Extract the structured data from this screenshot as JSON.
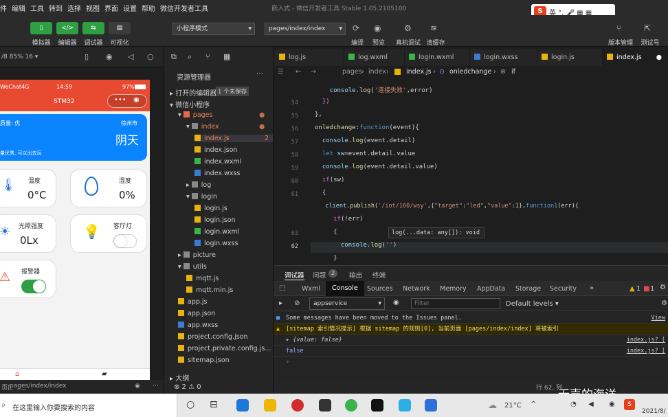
{
  "menu": [
    "件",
    "编辑",
    "工具",
    "转到",
    "选择",
    "视图",
    "界面",
    "设置",
    "帮助",
    "微信开发者工具"
  ],
  "window_title": "嵌入式 - 微信开发者工具 Stable 1.05.2105100",
  "ime": {
    "logo": "S",
    "text": "英 °, 🎤 ▦ ▦"
  },
  "toolbar": {
    "buttons": [
      {
        "label": "模拟器",
        "color": "#2ea043"
      },
      {
        "label": "编辑器",
        "color": "#2ea043"
      },
      {
        "label": "调试器",
        "color": "#2ea043"
      },
      {
        "label": "可视化",
        "color": "#3c3c3c"
      }
    ],
    "mode_select": "小程序模式",
    "page_select": "pages/index/index",
    "actions": [
      "编译",
      "预览",
      "真机调试",
      "清缓存"
    ],
    "right_actions": [
      "版本管理",
      "测试号"
    ]
  },
  "sim_header": {
    "zoom": "/8 85% 16 ▾"
  },
  "phone": {
    "status_carrier": "WeChat4G",
    "status_time": "14:59",
    "status_battery": "97%",
    "nav_title": "STM32",
    "weather": {
      "quality": "质量: 优",
      "city": "徐州市",
      "condition": "阴天",
      "tip": "量优秀, 可以出去玩"
    },
    "cards": [
      {
        "title": "温度",
        "value": "0°C",
        "icon": "thermometer-icon"
      },
      {
        "title": "湿度",
        "value": "0%",
        "icon": "water-drop-icon"
      },
      {
        "title": "光照强度",
        "value": "0Lx",
        "icon": "sun-icon"
      },
      {
        "title": "客厅灯",
        "value": "",
        "icon": "bulb-icon",
        "switch": false
      },
      {
        "title": "报警器",
        "value": "",
        "icon": "alarm-icon",
        "switch": true
      }
    ]
  },
  "sim_footer": {
    "path": "pages/index/index"
  },
  "explorer": {
    "title": "资源管理器",
    "open_editors": "打开的编辑器",
    "unsaved": "1 个未保存",
    "project": "微信小程序",
    "items": [
      {
        "name": "pages",
        "depth": 1,
        "kind": "folder",
        "dot": true
      },
      {
        "name": "index",
        "depth": 2,
        "kind": "folder",
        "dot": true
      },
      {
        "name": "index.js",
        "depth": 3,
        "kind": "js",
        "badge": "2",
        "selected": true
      },
      {
        "name": "index.json",
        "depth": 3,
        "kind": "json"
      },
      {
        "name": "index.wxml",
        "depth": 3,
        "kind": "wxml"
      },
      {
        "name": "index.wxss",
        "depth": 3,
        "kind": "wxss"
      },
      {
        "name": "log",
        "depth": 2,
        "kind": "folder"
      },
      {
        "name": "login",
        "depth": 2,
        "kind": "folder"
      },
      {
        "name": "login.js",
        "depth": 3,
        "kind": "js"
      },
      {
        "name": "login.json",
        "depth": 3,
        "kind": "json"
      },
      {
        "name": "login.wxml",
        "depth": 3,
        "kind": "wxml"
      },
      {
        "name": "login.wxss",
        "depth": 3,
        "kind": "wxss"
      },
      {
        "name": "picture",
        "depth": 1,
        "kind": "folder"
      },
      {
        "name": "utils",
        "depth": 1,
        "kind": "folder"
      },
      {
        "name": "mqtt.js",
        "depth": 2,
        "kind": "js"
      },
      {
        "name": "mqtt.min.js",
        "depth": 2,
        "kind": "js"
      },
      {
        "name": "app.js",
        "depth": 1,
        "kind": "js"
      },
      {
        "name": "app.json",
        "depth": 1,
        "kind": "json"
      },
      {
        "name": "app.wxss",
        "depth": 1,
        "kind": "wxss"
      },
      {
        "name": "project.config.json",
        "depth": 1,
        "kind": "json"
      },
      {
        "name": "project.private.config.js...",
        "depth": 1,
        "kind": "json"
      },
      {
        "name": "sitemap.json",
        "depth": 1,
        "kind": "json"
      }
    ],
    "outline": "大纲",
    "footer": "⊗ 2 ⚠ 0"
  },
  "tabs": [
    "log.js",
    "log.wxml",
    "login.wxml",
    "login.wxss",
    "login.js",
    "index.js"
  ],
  "breadcrumb": {
    "a": "pages",
    "b": "index",
    "c": "index.js",
    "d": "onledchange",
    "e": "if"
  },
  "code": {
    "line_numbers": [
      "",
      "54",
      "55",
      "56",
      "57",
      "58",
      "59",
      "60",
      "61",
      "",
      "62",
      "63"
    ],
    "hint": "log(...data: any[]): void"
  },
  "devtools": {
    "top_tabs": [
      "调试器",
      "问题",
      "输出",
      "终端"
    ],
    "problems_count": "2",
    "panel_tabs": [
      "Wxml",
      "Console",
      "Sources",
      "Network",
      "Memory",
      "AppData",
      "Storage",
      "Security"
    ],
    "warn_count": "1",
    "err_count": "1",
    "context": "appservice",
    "filter_placeholder": "Filter",
    "levels": "Default levels ▾",
    "msgs": [
      {
        "text": "Some messages have been moved to the Issues panel.",
        "link": "View"
      },
      {
        "text": "[sitemap 索引情况提示] 根据 sitemap 的规则[0], 当前页面 [pages/index/index] 将被索引",
        "link": ""
      },
      {
        "text": "▸ {value: false}",
        "link": "index.js? ["
      },
      {
        "text": "false",
        "link": "index.js? ["
      }
    ]
  },
  "editor_footer": "行 62, 列 ...",
  "danmu": "无声的海洋",
  "taskbar": {
    "search": "在这里输入你要搜索的内容",
    "temp": "21°C",
    "date": "2021/8/"
  }
}
